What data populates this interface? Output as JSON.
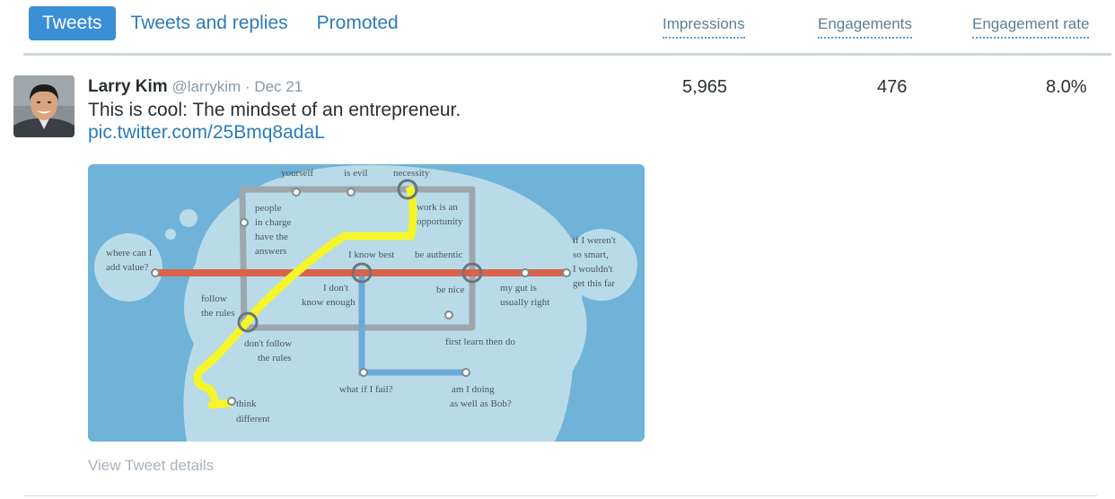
{
  "tabs": [
    {
      "label": "Tweets",
      "active": true
    },
    {
      "label": "Tweets and replies",
      "active": false
    },
    {
      "label": "Promoted",
      "active": false
    }
  ],
  "columns": {
    "impressions": "Impressions",
    "engagements": "Engagements",
    "engagement_rate": "Engagement rate"
  },
  "tweet": {
    "author_name": "Larry Kim",
    "handle": "@larrykim",
    "separator": "·",
    "date": "Dec 21",
    "text": "This is cool: The mindset of an entrepreneur.",
    "link": "pic.twitter.com/25Bmq8adaL",
    "impressions": "5,965",
    "engagements": "476",
    "engagement_rate": "8.0%",
    "details_link": "View Tweet details"
  },
  "map_labels": {
    "yourself": "yourself",
    "is_evil": "is evil",
    "necessity": "necessity",
    "people_1": "people",
    "people_2": "in charge",
    "people_3": "have the",
    "people_4": "answers",
    "work_1": "work is an",
    "work_2": "opportunity",
    "where_1": "where can I",
    "where_2": "add value?",
    "know_best": "I know best",
    "authentic": "be authentic",
    "ifnot_1": "if I weren't",
    "ifnot_2": "so smart,",
    "ifnot_3": "I wouldn't",
    "ifnot_4": "get this far",
    "follow_1": "follow",
    "follow_2": "the rules",
    "dont_know_1": "I don't",
    "dont_know_2": "know enough",
    "be_nice": "be nice",
    "gut_1": "my gut is",
    "gut_2": "usually right",
    "dont_follow_1": "don't follow",
    "dont_follow_2": "the rules",
    "first_learn": "first learn then do",
    "think_1": "think",
    "think_2": "different",
    "what_fail": "what if I fail?",
    "bob_1": "am I doing",
    "bob_2": "as well as Bob?"
  },
  "colors": {
    "accent": "#3b8fd6",
    "link": "#2b7bb9",
    "muted": "#8899a6",
    "map_bg": "#6fb3d9",
    "map_head": "#b9dbe8",
    "line_red": "#d9634a",
    "line_yellow": "#f5f52a",
    "line_gray": "#9ca7ad",
    "line_blue": "#6aaad8"
  }
}
